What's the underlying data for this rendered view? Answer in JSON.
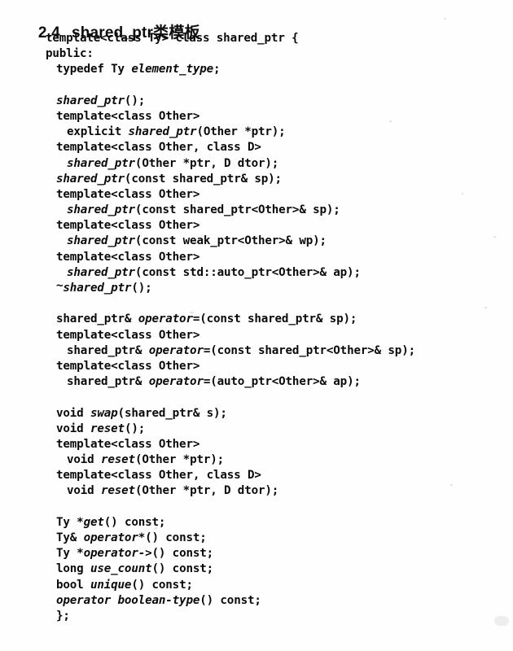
{
  "heading": {
    "number": "2.4",
    "title": "shared_ptr类模板"
  },
  "code": {
    "language": "cpp",
    "lines": [
      {
        "indent": 0,
        "parts": [
          {
            "text": "template<class Ty> class shared_ptr {",
            "style": "normal"
          }
        ]
      },
      {
        "indent": 0,
        "parts": [
          {
            "text": "public:",
            "style": "normal"
          }
        ]
      },
      {
        "indent": 1,
        "parts": [
          {
            "text": "typedef Ty ",
            "style": "normal"
          },
          {
            "text": "element_type",
            "style": "italic"
          },
          {
            "text": ";",
            "style": "normal"
          }
        ]
      },
      {
        "indent": 0,
        "parts": [
          {
            "text": "",
            "style": "blank"
          }
        ]
      },
      {
        "indent": 1,
        "parts": [
          {
            "text": "shared_ptr",
            "style": "italic"
          },
          {
            "text": "();",
            "style": "normal"
          }
        ]
      },
      {
        "indent": 1,
        "parts": [
          {
            "text": "template<class Other>",
            "style": "normal"
          }
        ]
      },
      {
        "indent": 2,
        "parts": [
          {
            "text": "explicit ",
            "style": "normal"
          },
          {
            "text": "shared_ptr",
            "style": "italic"
          },
          {
            "text": "(Other *ptr);",
            "style": "normal"
          }
        ]
      },
      {
        "indent": 1,
        "parts": [
          {
            "text": "template<class Other, class D>",
            "style": "normal"
          }
        ]
      },
      {
        "indent": 2,
        "parts": [
          {
            "text": "shared_ptr",
            "style": "italic"
          },
          {
            "text": "(Other *ptr, D dtor);",
            "style": "normal"
          }
        ]
      },
      {
        "indent": 1,
        "parts": [
          {
            "text": "shared_ptr",
            "style": "italic"
          },
          {
            "text": "(const shared_ptr& sp);",
            "style": "normal"
          }
        ]
      },
      {
        "indent": 1,
        "parts": [
          {
            "text": "template<class Other>",
            "style": "normal"
          }
        ]
      },
      {
        "indent": 2,
        "parts": [
          {
            "text": "shared_ptr",
            "style": "italic"
          },
          {
            "text": "(const shared_ptr<Other>& sp);",
            "style": "normal"
          }
        ]
      },
      {
        "indent": 1,
        "parts": [
          {
            "text": "template<class Other>",
            "style": "normal"
          }
        ]
      },
      {
        "indent": 2,
        "parts": [
          {
            "text": "shared_ptr",
            "style": "italic"
          },
          {
            "text": "(const weak_ptr<Other>& wp);",
            "style": "normal"
          }
        ]
      },
      {
        "indent": 1,
        "parts": [
          {
            "text": "template<class Other>",
            "style": "normal"
          }
        ]
      },
      {
        "indent": 2,
        "parts": [
          {
            "text": "shared_ptr",
            "style": "italic"
          },
          {
            "text": "(const std::auto_ptr<Other>& ap);",
            "style": "normal"
          }
        ]
      },
      {
        "indent": 1,
        "parts": [
          {
            "text": "~",
            "style": "tilde"
          },
          {
            "text": "shared_ptr",
            "style": "italic"
          },
          {
            "text": "();",
            "style": "normal"
          }
        ]
      },
      {
        "indent": 0,
        "parts": [
          {
            "text": "",
            "style": "blank"
          }
        ]
      },
      {
        "indent": 1,
        "parts": [
          {
            "text": "shared_ptr& ",
            "style": "normal"
          },
          {
            "text": "operator=",
            "style": "italic"
          },
          {
            "text": "(const shared_ptr& sp);",
            "style": "normal"
          }
        ]
      },
      {
        "indent": 1,
        "parts": [
          {
            "text": "template<class Other>",
            "style": "normal"
          }
        ]
      },
      {
        "indent": 2,
        "parts": [
          {
            "text": "shared_ptr& ",
            "style": "normal"
          },
          {
            "text": "operator=",
            "style": "italic"
          },
          {
            "text": "(const shared_ptr<Other>& sp);",
            "style": "normal"
          }
        ]
      },
      {
        "indent": 1,
        "parts": [
          {
            "text": "template<class Other>",
            "style": "normal"
          }
        ]
      },
      {
        "indent": 2,
        "parts": [
          {
            "text": "shared_ptr& ",
            "style": "normal"
          },
          {
            "text": "operator=",
            "style": "italic"
          },
          {
            "text": "(auto_ptr<Other>& ap);",
            "style": "normal"
          }
        ]
      },
      {
        "indent": 0,
        "parts": [
          {
            "text": "",
            "style": "blank"
          }
        ]
      },
      {
        "indent": 1,
        "parts": [
          {
            "text": "void ",
            "style": "normal"
          },
          {
            "text": "swap",
            "style": "italic"
          },
          {
            "text": "(shared_ptr& s);",
            "style": "normal"
          }
        ]
      },
      {
        "indent": 1,
        "parts": [
          {
            "text": "void ",
            "style": "normal"
          },
          {
            "text": "reset",
            "style": "italic"
          },
          {
            "text": "();",
            "style": "normal"
          }
        ]
      },
      {
        "indent": 1,
        "parts": [
          {
            "text": "template<class Other>",
            "style": "normal"
          }
        ]
      },
      {
        "indent": 2,
        "parts": [
          {
            "text": "void ",
            "style": "normal"
          },
          {
            "text": "reset",
            "style": "italic"
          },
          {
            "text": "(Other *ptr);",
            "style": "normal"
          }
        ]
      },
      {
        "indent": 1,
        "parts": [
          {
            "text": "template<class Other, class D>",
            "style": "normal"
          }
        ]
      },
      {
        "indent": 2,
        "parts": [
          {
            "text": "void ",
            "style": "normal"
          },
          {
            "text": "reset",
            "style": "italic"
          },
          {
            "text": "(Other *ptr, D dtor);",
            "style": "normal"
          }
        ]
      },
      {
        "indent": 0,
        "parts": [
          {
            "text": "",
            "style": "blank"
          }
        ]
      },
      {
        "indent": 1,
        "parts": [
          {
            "text": "Ty *",
            "style": "normal"
          },
          {
            "text": "get",
            "style": "italic"
          },
          {
            "text": "() const;",
            "style": "normal"
          }
        ]
      },
      {
        "indent": 1,
        "parts": [
          {
            "text": "Ty& ",
            "style": "normal"
          },
          {
            "text": "operator*",
            "style": "italic"
          },
          {
            "text": "() const;",
            "style": "normal"
          }
        ]
      },
      {
        "indent": 1,
        "parts": [
          {
            "text": "Ty *",
            "style": "normal"
          },
          {
            "text": "operator->",
            "style": "italic"
          },
          {
            "text": "() const;",
            "style": "normal"
          }
        ]
      },
      {
        "indent": 1,
        "parts": [
          {
            "text": "long ",
            "style": "normal"
          },
          {
            "text": "use_count",
            "style": "italic"
          },
          {
            "text": "() const;",
            "style": "normal"
          }
        ]
      },
      {
        "indent": 1,
        "parts": [
          {
            "text": "bool ",
            "style": "normal"
          },
          {
            "text": "unique",
            "style": "italic"
          },
          {
            "text": "() const;",
            "style": "normal"
          }
        ]
      },
      {
        "indent": 1,
        "parts": [
          {
            "text": "operator boolean-type",
            "style": "italic"
          },
          {
            "text": "() const;",
            "style": "normal"
          }
        ]
      },
      {
        "indent": 1,
        "parts": [
          {
            "text": "};",
            "style": "normal"
          }
        ]
      }
    ]
  },
  "colors": {
    "page_background": "#fefefe",
    "text": "#0a0a0a",
    "heading": "#0d0d0d"
  }
}
